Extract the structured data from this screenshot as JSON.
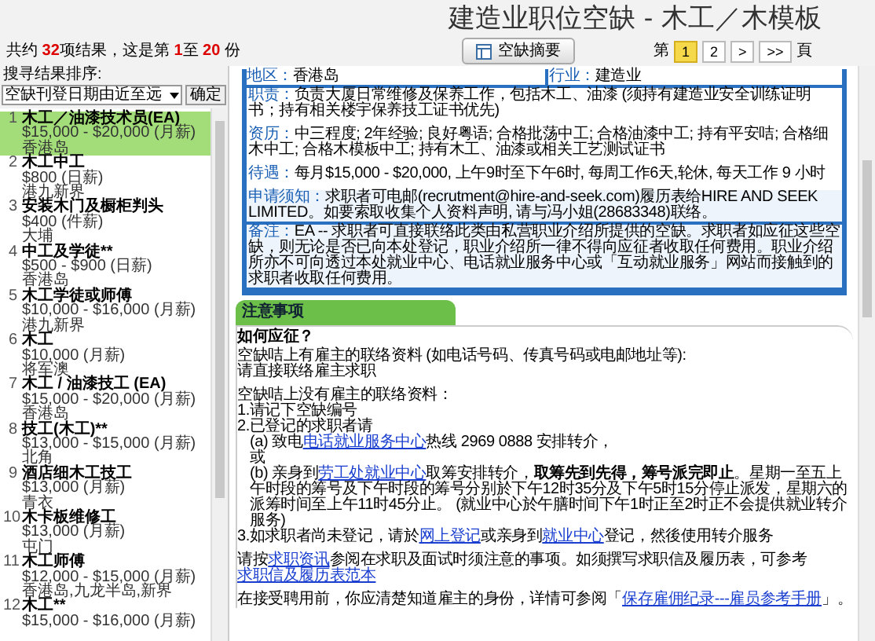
{
  "title": "建造业职位空缺 - 木工／木模板",
  "summary": {
    "prefix": "共约 ",
    "count": "32",
    "mid": "项结果，这是第 ",
    "from": "1",
    "to_label": "至 ",
    "to": "20",
    "suffix": " 份"
  },
  "summary_button": "空缺摘要",
  "pagination": {
    "before": "第",
    "after": "頁",
    "pages": [
      {
        "label": "1",
        "selected": true
      },
      {
        "label": "2",
        "selected": false
      },
      {
        "label": ">",
        "selected": false
      },
      {
        "label": ">>",
        "selected": false
      }
    ]
  },
  "sort": {
    "label": "搜寻结果排序:",
    "value": "空缺刊登日期由近至远",
    "button": "确定"
  },
  "jobs": [
    {
      "number": "1",
      "title": "木工／油漆技术员(EA)",
      "salary": "$15,000 - $20,000 (月薪)",
      "location": "香港岛",
      "selected": true
    },
    {
      "number": "2",
      "title": "木工中工",
      "salary": "$800 (日薪)",
      "location": "港九新界",
      "selected": false
    },
    {
      "number": "3",
      "title": "安装木门及橱柜判头",
      "salary": "$400 (件薪)",
      "location": "大埔",
      "selected": false
    },
    {
      "number": "4",
      "title": "中工及学徒**",
      "salary": "$500 - $900 (日薪)",
      "location": "香港岛",
      "selected": false
    },
    {
      "number": "5",
      "title": "木工学徒或师傅",
      "salary": "$10,000 - $16,000 (月薪)",
      "location": "港九新界",
      "selected": false
    },
    {
      "number": "6",
      "title": "木工",
      "salary": "$10,000 (月薪)",
      "location": "将军澳",
      "selected": false
    },
    {
      "number": "7",
      "title": "木工 / 油漆技工 (EA)",
      "salary": "$15,000 - $20,000 (月薪)",
      "location": "香港岛",
      "selected": false
    },
    {
      "number": "8",
      "title": "技工(木工)**",
      "salary": "$13,000 - $15,000 (月薪)",
      "location": "北角",
      "selected": false
    },
    {
      "number": "9",
      "title": "酒店细木工技工",
      "salary": "$13,000 (月薪)",
      "location": "青衣",
      "selected": false
    },
    {
      "number": "10",
      "title": "木卡板维修工",
      "salary": "$13,000 (月薪)",
      "location": "屯门",
      "selected": false
    },
    {
      "number": "11",
      "title": "木工师傅",
      "salary": "$12,000 - $15,000 (月薪)",
      "location": "香港岛,九龙半岛,新界",
      "selected": false
    },
    {
      "number": "12",
      "title": "木工**",
      "salary": "$15,000 - $16,000 (月薪)",
      "selected": false
    }
  ],
  "detail": {
    "region": {
      "label": "地区：",
      "value": "香港岛"
    },
    "industry": {
      "label": "行业：",
      "value": "建造业"
    },
    "fields": [
      {
        "label": "职责：",
        "value": "负责大厦日常维修及保养工作，包括木工、油漆 (须持有建造业安全训练证明书；持有相关楼宇保养技工证书优先)",
        "shaded": false
      },
      {
        "label": "资历：",
        "value": "中三程度; 2年经验; 良好粤语; 合格批荡中工; 合格油漆中工; 持有平安咭; 合格细木中工; 合格木模板中工; 持有木工、油漆或相关工艺测试证书",
        "shaded": false
      },
      {
        "label": "待遇：",
        "value": "每月$15,000 - $20,000, 上午9时至下午6时, 每周工作6天,轮休, 每天工作 9 小时",
        "shaded": false
      },
      {
        "label": "申请须知：",
        "value": "求职者可电邮(recrutment@hire-and-seek.com)履历表给HIRE AND SEEK LIMITED。如要索取收集个人资料声明, 请与冯小姐(28683348)联络。",
        "shaded": true
      },
      {
        "label": "备注：",
        "value": "EA -- 求职者可直接联络此类由私营职业介绍所提供的空缺。求职者如应征这些空缺，则无论是否已向本处登记，职业介绍所一律不得向应征者收取任何费用。职业介绍所亦不可向透过本处就业中心、电话就业服务中心或「互动就业服务」网站而接触到的求职者收取任何费用。",
        "shaded": true
      }
    ]
  },
  "notes": {
    "tab": "注意事项",
    "heading": "如何应征？",
    "paragraphs": [
      {
        "gap": false,
        "parts": [
          {
            "kind": "text",
            "text": "空缺咭上有雇主的联络资料 (如电话号码、传真号码或电邮地址等):"
          }
        ]
      },
      {
        "gap": false,
        "parts": [
          {
            "kind": "text",
            "text": "请直接联络雇主求职"
          }
        ]
      },
      {
        "gap": true,
        "parts": [
          {
            "kind": "text",
            "text": "空缺咭上没有雇主的联络资料："
          }
        ]
      },
      {
        "gap": false,
        "parts": [
          {
            "kind": "text",
            "text": "1.请记下空缺编号"
          }
        ]
      },
      {
        "gap": false,
        "parts": [
          {
            "kind": "text",
            "text": "2.已登记的求职者请"
          }
        ]
      },
      {
        "gap": false,
        "indent": true,
        "parts": [
          {
            "kind": "text",
            "text": "(a) 致电"
          },
          {
            "kind": "link",
            "text": "电话就业服务中心"
          },
          {
            "kind": "text",
            "text": "热线 2969 0888 安排转介，"
          }
        ]
      },
      {
        "gap": false,
        "indent": true,
        "parts": [
          {
            "kind": "text",
            "text": "或"
          }
        ]
      },
      {
        "gap": false,
        "indent": true,
        "parts": [
          {
            "kind": "text",
            "text": "(b) 亲身到"
          },
          {
            "kind": "link",
            "text": "劳工处就业中心"
          },
          {
            "kind": "text",
            "text": "取筹安排转介，"
          },
          {
            "kind": "bold",
            "text": "取筹先到先得，筹号派完即止"
          },
          {
            "kind": "text",
            "text": "。星期一至五上午时段的筹号及下午时段的筹号分别於下午12时35分及下午5时15分停止派发，星期六的派筹时间至上午11时45分止。 (就业中心於午膳时间下午1时正至2时正不会提供就业转介服务)"
          }
        ]
      },
      {
        "gap": false,
        "parts": [
          {
            "kind": "text",
            "text": "3.如求职者尚未登记，请於"
          },
          {
            "kind": "link",
            "text": "网上登记"
          },
          {
            "kind": "text",
            "text": "或亲身到"
          },
          {
            "kind": "link",
            "text": "就业中心"
          },
          {
            "kind": "text",
            "text": "登记，然後使用转介服务"
          }
        ]
      },
      {
        "gap": true,
        "parts": [
          {
            "kind": "text",
            "text": "请按"
          },
          {
            "kind": "link",
            "text": "求职资讯"
          },
          {
            "kind": "text",
            "text": "参阅在求职及面试时须注意的事项。如须撰写求职信及履历表，可参考"
          },
          {
            "kind": "link",
            "text": "求职信及履历表范本"
          }
        ]
      },
      {
        "gap": true,
        "parts": [
          {
            "kind": "text",
            "text": "在接受聘用前，你应清楚知道雇主的身份，详情可参阅「"
          },
          {
            "kind": "link",
            "text": "保存雇佣纪录---雇员参考手册"
          },
          {
            "kind": "text",
            "text": "」。"
          }
        ]
      }
    ]
  }
}
